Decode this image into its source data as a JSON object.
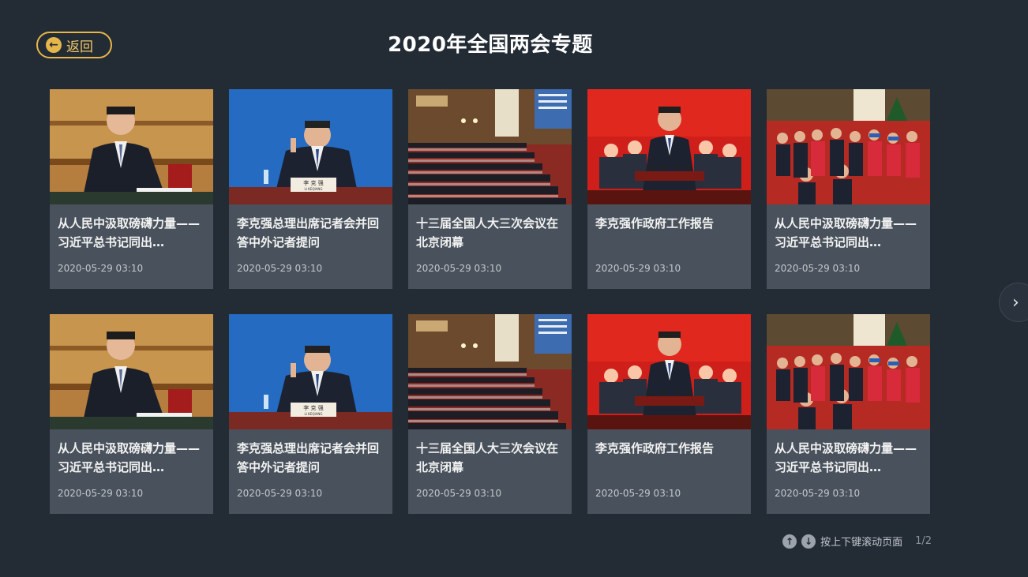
{
  "header": {
    "back_label": "返回",
    "title": "2020年全国两会专题"
  },
  "cards": [
    {
      "title": "从人民中汲取磅礴力量——习近平总书记同出…",
      "date": "2020-05-29 03:10",
      "image": "xi-meeting-photo"
    },
    {
      "title": "李克强总理出席记者会并回答中外记者提问",
      "date": "2020-05-29 03:10",
      "image": "li-press-conference-photo"
    },
    {
      "title": "十三届全国人大三次会议在北京闭幕",
      "date": "2020-05-29 03:10",
      "image": "npc-hall-photo"
    },
    {
      "title": "李克强作政府工作报告",
      "date": "2020-05-29 03:10",
      "image": "li-government-report-photo"
    },
    {
      "title": "从人民中汲取磅礴力量——习近平总书记同出…",
      "date": "2020-05-29 03:10",
      "image": "delegates-photo"
    },
    {
      "title": "从人民中汲取磅礴力量——习近平总书记同出…",
      "date": "2020-05-29 03:10",
      "image": "xi-meeting-photo"
    },
    {
      "title": "李克强总理出席记者会并回答中外记者提问",
      "date": "2020-05-29 03:10",
      "image": "li-press-conference-photo"
    },
    {
      "title": "十三届全国人大三次会议在北京闭幕",
      "date": "2020-05-29 03:10",
      "image": "npc-hall-photo"
    },
    {
      "title": "李克强作政府工作报告",
      "date": "2020-05-29 03:10",
      "image": "li-government-report-photo"
    },
    {
      "title": "从人民中汲取磅礴力量——习近平总书记同出…",
      "date": "2020-05-29 03:10",
      "image": "delegates-photo"
    }
  ],
  "footer": {
    "hint": "按上下键滚动页面",
    "page_indicator": "1/2",
    "nameplate_cn": "李 克 强",
    "nameplate_en": "LI KEQIANG"
  },
  "colors": {
    "background": "#232b35",
    "card": "#49525c",
    "accent": "#e6b64a"
  },
  "icons": {
    "back": "arrow-left-icon",
    "next": "chevron-right-icon",
    "up": "arrow-up-icon",
    "down": "arrow-down-icon"
  }
}
